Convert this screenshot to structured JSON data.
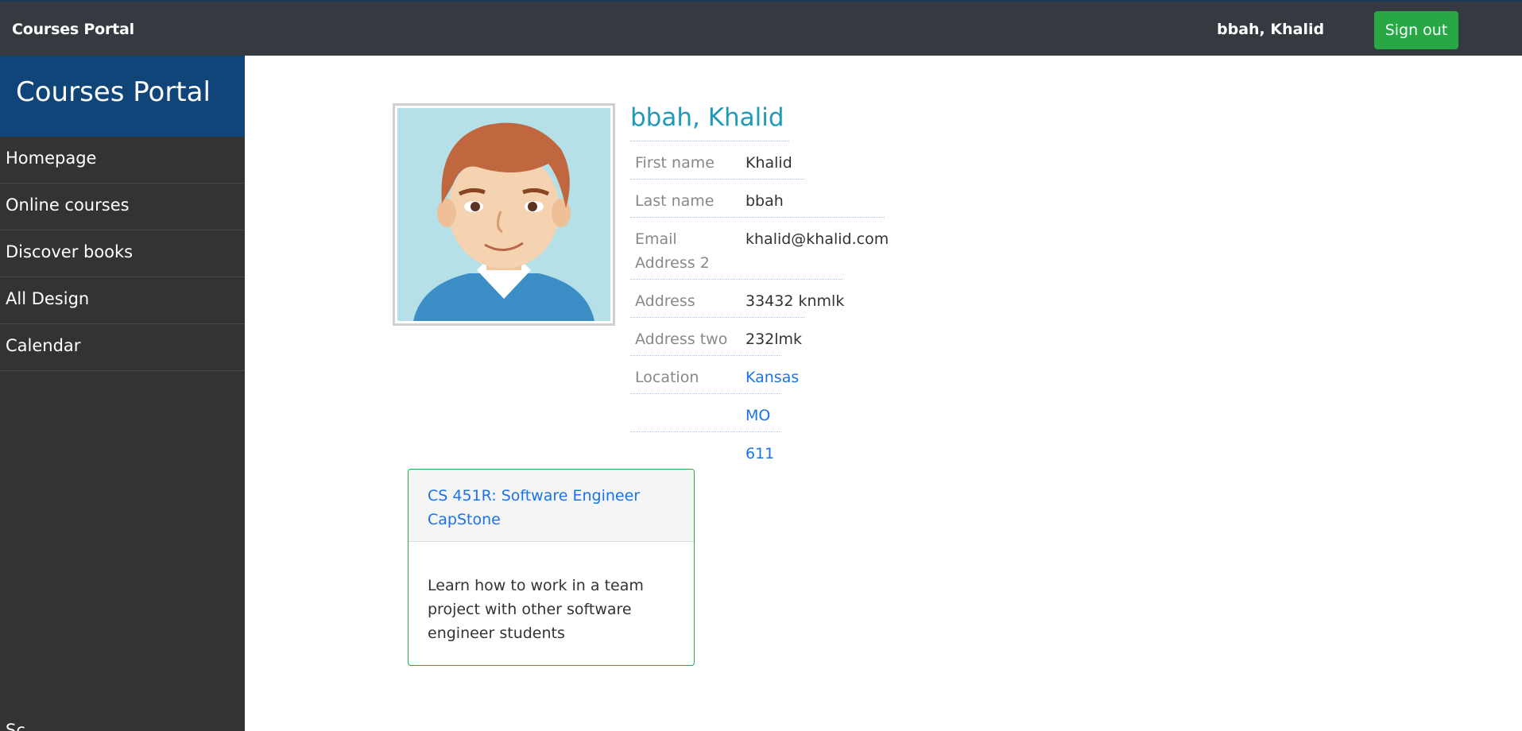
{
  "topbar": {
    "brand": "Courses Portal",
    "user": "bbah, Khalid",
    "signout_label": "Sign out"
  },
  "sidebar": {
    "title": "Courses Portal",
    "items": [
      {
        "label": "Homepage"
      },
      {
        "label": "Online courses"
      },
      {
        "label": "Discover books"
      },
      {
        "label": "All Design"
      },
      {
        "label": "Calendar"
      }
    ],
    "bottom_partial": "Sc..."
  },
  "profile": {
    "name": "bbah, Khalid",
    "fields": {
      "first_name_label": "First name",
      "first_name": "Khalid",
      "last_name_label": "Last name",
      "last_name": "bbah",
      "email_label": "Email Address 2",
      "email": "khalid@khalid.com",
      "address_label": "Address",
      "address": "33432 knmlk",
      "address_two_label": "Address two",
      "address_two": "232lmk",
      "location_label": "Location",
      "city": "Kansas",
      "state": "MO",
      "zip": "611"
    }
  },
  "course": {
    "title": "CS 451R: Software Engineer CapStone",
    "description": "Learn how to work in a team project with other software engineer students"
  },
  "colors": {
    "topbar": "#343a40",
    "sidebar": "#333333",
    "sidebar_header": "#10457a",
    "accent_green": "#28a745",
    "name_teal": "#1f9ab7",
    "link_blue": "#1a73e8"
  },
  "icons": {
    "avatar": "cartoon-man-avatar"
  }
}
